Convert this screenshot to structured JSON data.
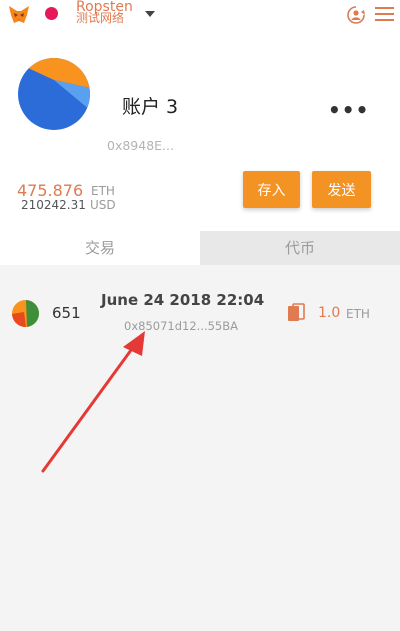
{
  "topbar": {
    "network_name": "Ropsten",
    "network_subtitle": "测试网络",
    "network_color": "#e5185a",
    "icons": [
      "metamask-fox-icon",
      "chevron-down-icon",
      "account-switch-icon",
      "hamburger-menu-icon"
    ]
  },
  "account": {
    "name": "账户 3",
    "address": "0x8948E...",
    "balance_eth": "475.876",
    "balance_eth_unit": "ETH",
    "balance_usd": "210242.31",
    "balance_usd_unit": "USD",
    "deposit_label": "存入",
    "send_label": "发送",
    "more_label": "•••"
  },
  "tabs": [
    {
      "label": "交易",
      "active": true
    },
    {
      "label": "代币",
      "active": false
    }
  ],
  "transactions": [
    {
      "nonce": "651",
      "date": "June 24 2018 22:04",
      "hash": "0x85071d12...55BA",
      "amount": "1.0",
      "unit": "ETH"
    }
  ],
  "colors": {
    "accent": "#f39323",
    "balance_text": "#e07a50",
    "annotation_arrow": "#e53935"
  }
}
